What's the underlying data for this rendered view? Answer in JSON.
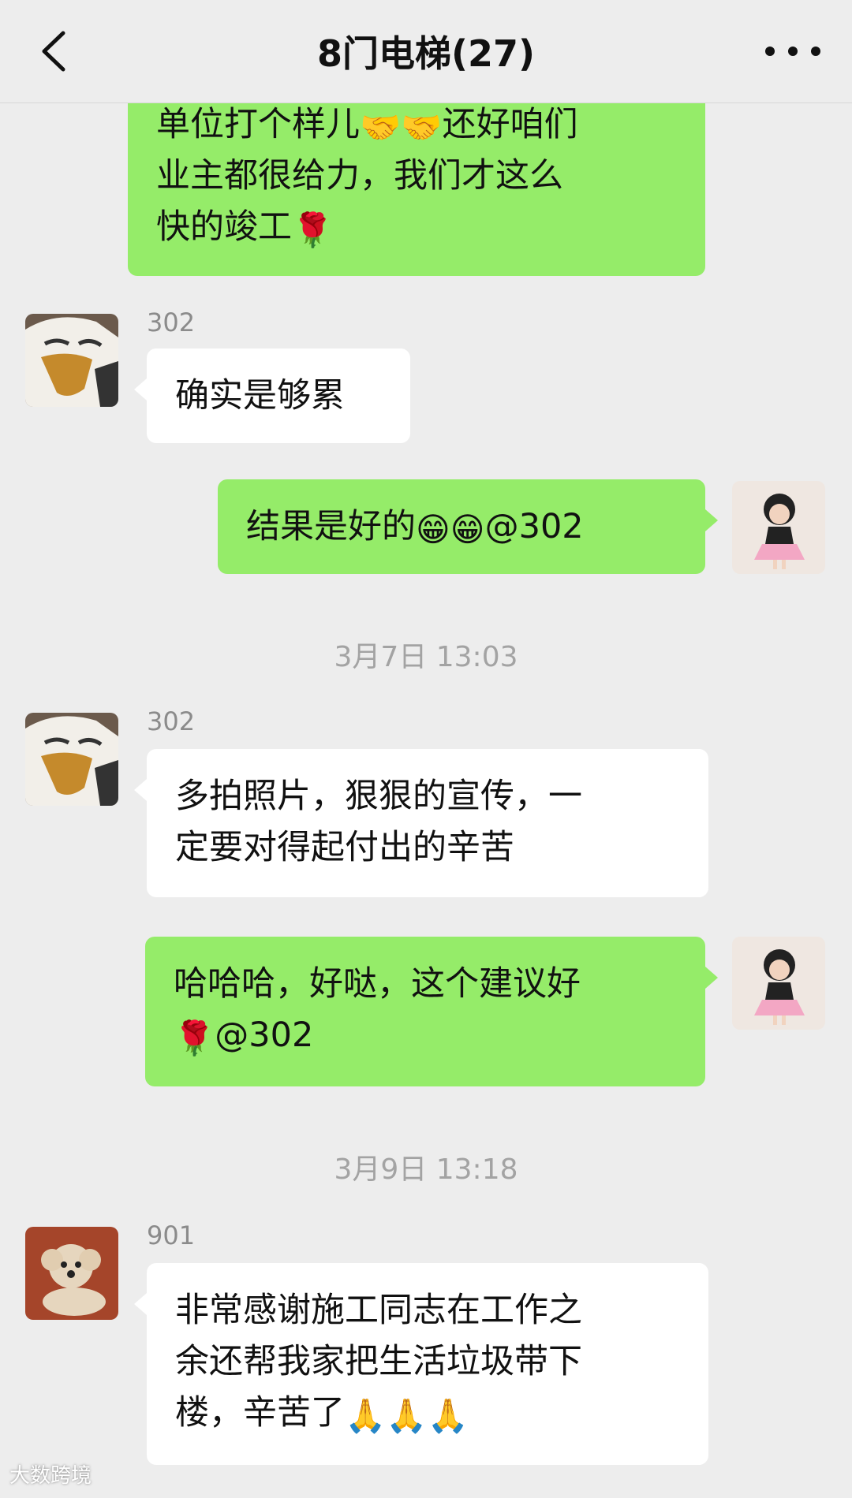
{
  "header": {
    "title": "8门电梯(27)"
  },
  "messages": [
    {
      "text_lines": [
        "单位打个样儿",
        "还好咱们",
        "业主都很给力，我们才这么",
        "快的竣工"
      ]
    },
    {
      "sender": "302",
      "text": "确实是够累"
    },
    {
      "text": "结果是好的",
      "mention": "@302"
    },
    {
      "time": "3月7日 13:03"
    },
    {
      "sender": "302",
      "line1": "多拍照片，狠狠的宣传，一",
      "line2": "定要对得起付出的辛苦"
    },
    {
      "line1": "哈哈哈，好哒，这个建议好",
      "mention": "@302"
    },
    {
      "time": "3月9日 13:18"
    },
    {
      "sender": "901",
      "line1": "非常感谢施工同志在工作之",
      "line2": "余还帮我家把生活垃圾带下",
      "line3": "楼，辛苦了"
    }
  ],
  "icons": {
    "back": "chevron-left-icon",
    "more": "more-dots-icon",
    "handshake": "🤝",
    "rose": "🌹",
    "grin": "😁",
    "pray": "🙏"
  },
  "watermark": "大数跨境",
  "colors": {
    "background": "#ededed",
    "self_bubble": "#95ec69",
    "other_bubble": "#ffffff"
  }
}
